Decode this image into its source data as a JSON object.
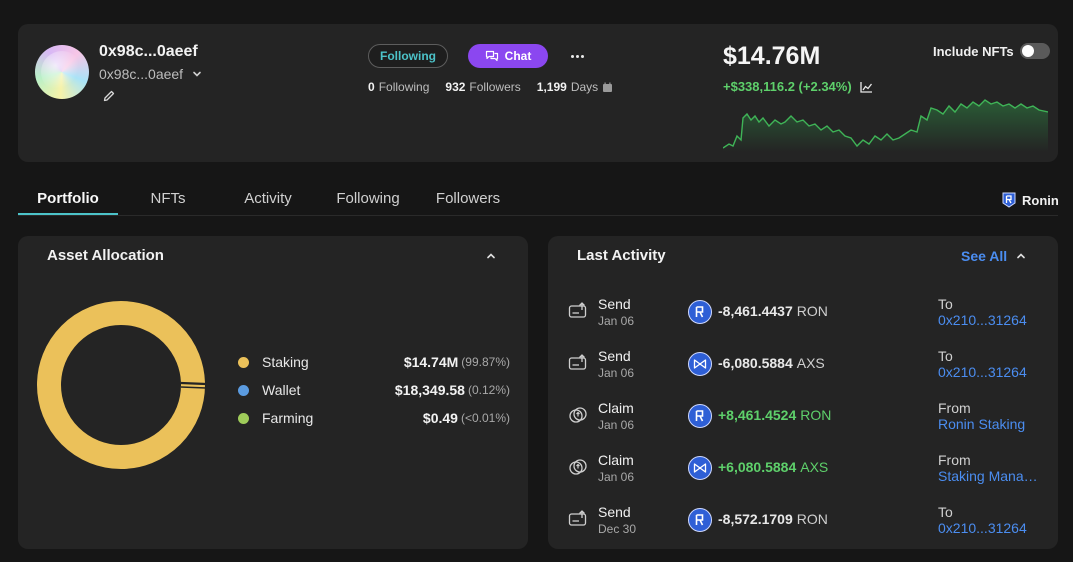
{
  "profile": {
    "name": "0x98c...0aeef",
    "address": "0x98c...0aeef",
    "following_button": "Following",
    "chat_button": "Chat",
    "stats": {
      "following_count": "0",
      "following_label": "Following",
      "followers_count": "932",
      "followers_label": "Followers",
      "days_count": "1,199",
      "days_label": "Days"
    },
    "balance": "$14.76M",
    "change": "+$338,116.2 (+2.34%)",
    "include_nfts_label": "Include NFTs",
    "include_nfts_on": false,
    "accent_color": "#5ed06b"
  },
  "tabs": [
    {
      "label": "Portfolio",
      "active": true
    },
    {
      "label": "NFTs",
      "active": false
    },
    {
      "label": "Activity",
      "active": false
    },
    {
      "label": "Following",
      "active": false
    },
    {
      "label": "Followers",
      "active": false
    }
  ],
  "network": {
    "label": "Ronin",
    "icon": "ronin-icon"
  },
  "allocation": {
    "title": "Asset Allocation",
    "items": [
      {
        "label": "Staking",
        "value": "$14.74M",
        "pct": "(99.87%)",
        "share": 99.87,
        "color": "#ebc15a"
      },
      {
        "label": "Wallet",
        "value": "$18,349.58",
        "pct": "(0.12%)",
        "share": 0.12,
        "color": "#5b9be0"
      },
      {
        "label": "Farming",
        "value": "$0.49",
        "pct": "(<0.01%)",
        "share": 0.01,
        "color": "#9fcc5a"
      }
    ]
  },
  "activity": {
    "title": "Last Activity",
    "see_all": "See All",
    "rows": [
      {
        "type": "Send",
        "date": "Jan 06",
        "icon": "send-icon",
        "token": "ronin-token-icon",
        "amount": "-8,461.4437",
        "symbol": "RON",
        "positive": false,
        "dest_label": "To",
        "dest": "0x210...31264"
      },
      {
        "type": "Send",
        "date": "Jan 06",
        "icon": "send-icon",
        "token": "axs-token-icon",
        "amount": "-6,080.5884",
        "symbol": "AXS",
        "positive": false,
        "dest_label": "To",
        "dest": "0x210...31264"
      },
      {
        "type": "Claim",
        "date": "Jan 06",
        "icon": "claim-icon",
        "token": "ronin-token-icon",
        "amount": "+8,461.4524",
        "symbol": "RON",
        "positive": true,
        "dest_label": "From",
        "dest": "Ronin Staking"
      },
      {
        "type": "Claim",
        "date": "Jan 06",
        "icon": "claim-icon",
        "token": "axs-token-icon",
        "amount": "+6,080.5884",
        "symbol": "AXS",
        "positive": true,
        "dest_label": "From",
        "dest": "Staking Manager"
      },
      {
        "type": "Send",
        "date": "Dec 30",
        "icon": "send-icon",
        "token": "ronin-token-icon",
        "amount": "-8,572.1709",
        "symbol": "RON",
        "positive": false,
        "dest_label": "To",
        "dest": "0x210...31264"
      }
    ]
  }
}
